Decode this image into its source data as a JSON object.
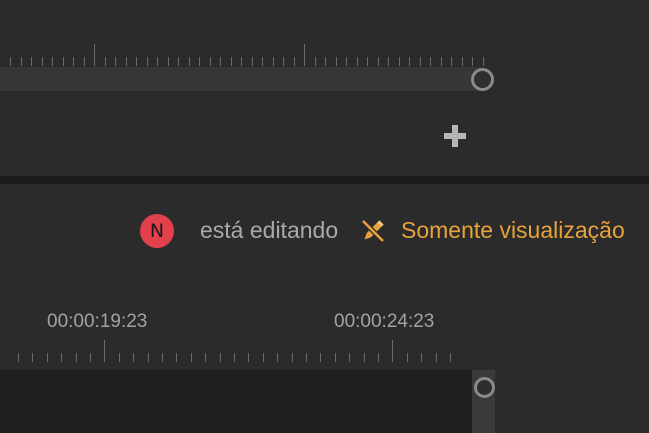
{
  "collaboration": {
    "user_initial": "N",
    "editing_label": "está editando",
    "permission_label": "Somente visualização"
  },
  "timeline": {
    "timecodes": [
      "00:00:19:23",
      "00:00:24:23"
    ]
  },
  "icons": {
    "add": "plus-icon",
    "permission": "pencil-crossed-icon"
  },
  "colors": {
    "avatar": "#e2404a",
    "permission_text": "#e8a33d",
    "panel_background": "#2b2b2b"
  }
}
